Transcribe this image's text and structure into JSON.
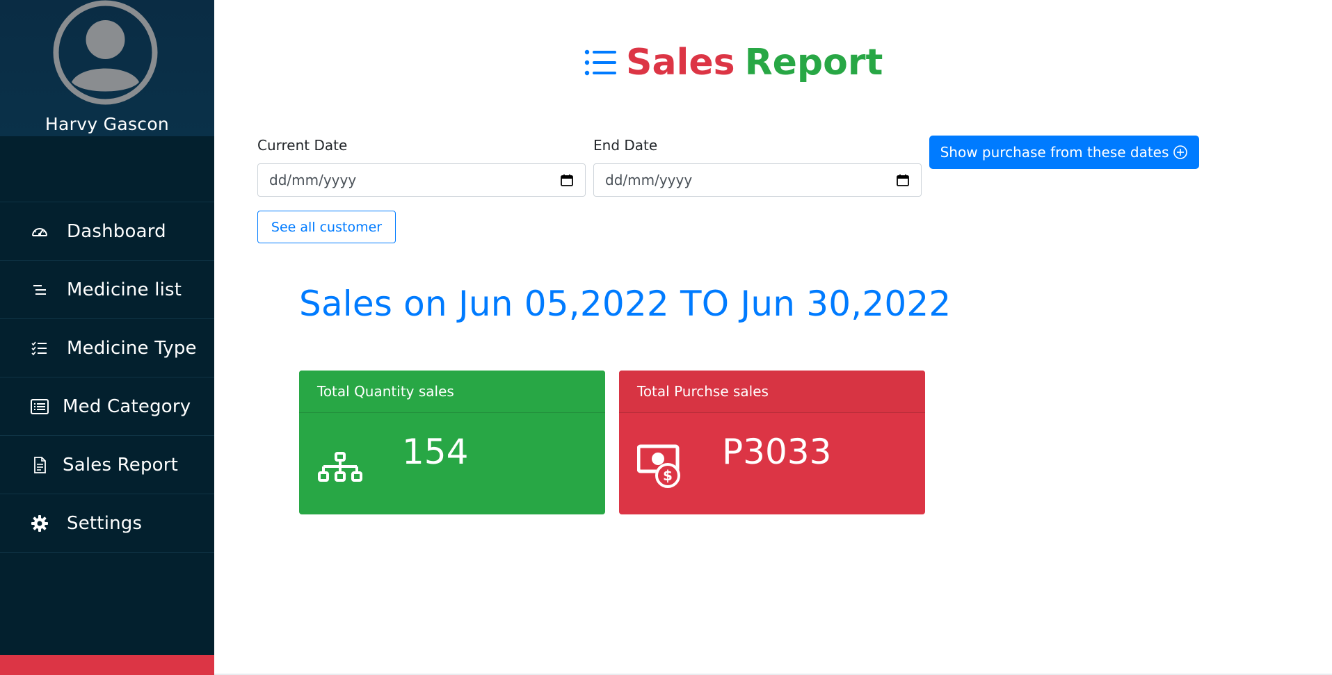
{
  "sidebar": {
    "user_name": "Harvy Gascon",
    "items": [
      {
        "label": "Dashboard",
        "icon": "gauge-icon"
      },
      {
        "label": "Medicine list",
        "icon": "lines-icon"
      },
      {
        "label": "Medicine Type",
        "icon": "checklist-icon"
      },
      {
        "label": "Med Category",
        "icon": "list-box-icon"
      },
      {
        "label": "Sales Report",
        "icon": "document-icon"
      },
      {
        "label": "Settings",
        "icon": "gear-icon"
      }
    ],
    "accent_color": "#dc3545"
  },
  "header": {
    "title_word1": "Sales",
    "title_word2": "Report",
    "title_icon": "list-icon"
  },
  "filters": {
    "current_date_label": "Current Date",
    "current_date_placeholder": "dd/mm/yyyy",
    "end_date_label": "End Date",
    "end_date_placeholder": "dd/mm/yyyy",
    "show_button_label": "Show purchase from these dates",
    "see_all_label": "See all customer"
  },
  "report": {
    "range_text": "Sales on Jun 05,2022 TO Jun 30,2022"
  },
  "cards": [
    {
      "title": "Total Quantity sales",
      "value": "154",
      "color": "#28a745",
      "icon": "sitemap-icon"
    },
    {
      "title": "Total Purchse sales",
      "value": "P3033",
      "color": "#dc3545",
      "icon": "money-dollar-icon"
    }
  ],
  "colors": {
    "primary": "#007bff",
    "sidebar_bg": "#03202e",
    "success": "#28a745",
    "danger": "#dc3545"
  }
}
